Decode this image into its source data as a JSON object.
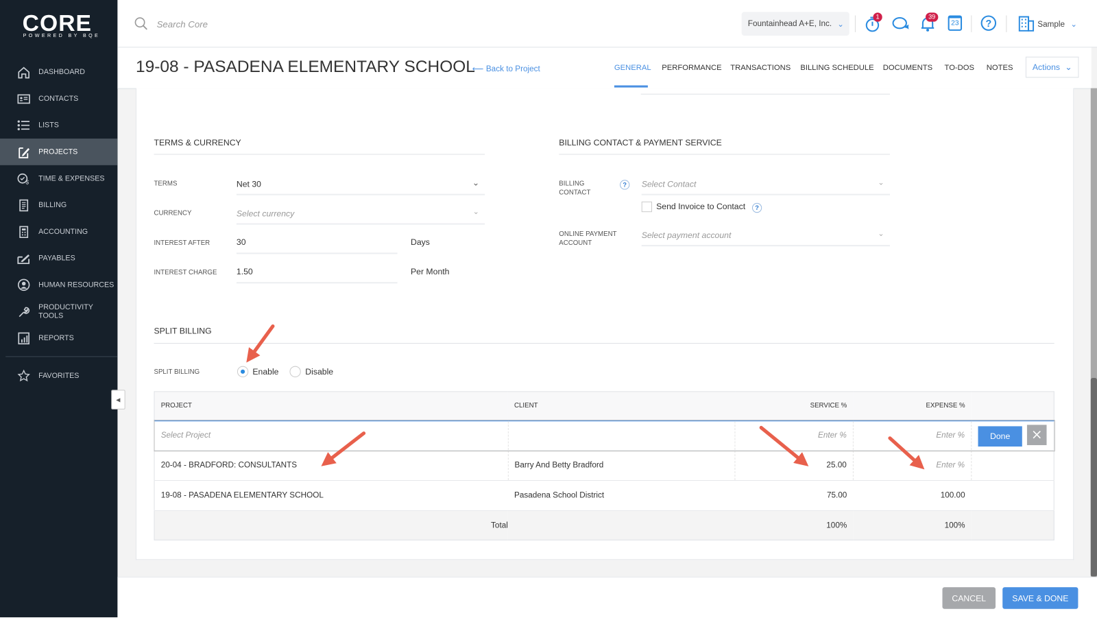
{
  "brand": {
    "logo": "CORE",
    "tagline": "POWERED BY BQE",
    "accent": "#4a90e2",
    "sidebar_bg": "#16202a",
    "annotation_arrow": "#e8604c"
  },
  "sidebar": {
    "items": [
      {
        "label": "DASHBOARD",
        "icon": "home-icon"
      },
      {
        "label": "CONTACTS",
        "icon": "contact-card-icon"
      },
      {
        "label": "LISTS",
        "icon": "list-icon"
      },
      {
        "label": "PROJECTS",
        "icon": "clipboard-edit-icon",
        "active": true
      },
      {
        "label": "TIME & EXPENSES",
        "icon": "clock-money-icon"
      },
      {
        "label": "BILLING",
        "icon": "invoice-icon"
      },
      {
        "label": "ACCOUNTING",
        "icon": "calculator-icon"
      },
      {
        "label": "PAYABLES",
        "icon": "check-signature-icon"
      },
      {
        "label": "HUMAN RESOURCES",
        "icon": "person-icon"
      },
      {
        "label": "PRODUCTIVITY TOOLS",
        "icon": "wrench-icon"
      },
      {
        "label": "REPORTS",
        "icon": "chart-icon"
      }
    ],
    "favorites": {
      "label": "FAVORITES",
      "icon": "star-icon"
    }
  },
  "topbar": {
    "search_placeholder": "Search Core",
    "company": "Fountainhead A+E, Inc.",
    "timer_badge": "1",
    "notifications_badge": "39",
    "calendar_day": "23",
    "user": "Sample"
  },
  "header": {
    "title": "19-08 - PASADENA ELEMENTARY SCHOOL",
    "back_link": "Back to Project",
    "tabs": [
      {
        "label": "GENERAL",
        "active": true
      },
      {
        "label": "PERFORMANCE"
      },
      {
        "label": "TRANSACTIONS"
      },
      {
        "label": "BILLING SCHEDULE"
      },
      {
        "label": "DOCUMENTS"
      },
      {
        "label": "TO-DOS"
      },
      {
        "label": "NOTES"
      }
    ],
    "actions_label": "Actions"
  },
  "terms": {
    "title": "TERMS & CURRENCY",
    "terms_label": "TERMS",
    "terms_value": "Net 30",
    "currency_label": "CURRENCY",
    "currency_placeholder": "Select currency",
    "interest_after_label": "INTEREST AFTER",
    "interest_after_value": "30",
    "interest_after_unit": "Days",
    "interest_charge_label": "INTEREST CHARGE",
    "interest_charge_value": "1.50",
    "interest_charge_unit": "Per Month"
  },
  "billing_contact": {
    "title": "BILLING CONTACT & PAYMENT SERVICE",
    "contact_label_1": "BILLING",
    "contact_label_2": "CONTACT",
    "contact_placeholder": "Select Contact",
    "send_invoice_label": "Send Invoice to Contact",
    "send_invoice_checked": false,
    "payment_label_1": "ONLINE PAYMENT",
    "payment_label_2": "ACCOUNT",
    "payment_placeholder": "Select payment account"
  },
  "split_billing": {
    "title": "SPLIT BILLING",
    "label": "SPLIT BILLING",
    "options": [
      "Enable",
      "Disable"
    ],
    "selected": "Enable",
    "columns": [
      "PROJECT",
      "CLIENT",
      "SERVICE %",
      "EXPENSE %"
    ],
    "edit_row": {
      "project_placeholder": "Select Project",
      "service_placeholder": "Enter %",
      "expense_placeholder": "Enter %",
      "done_label": "Done"
    },
    "rows": [
      {
        "project": "20-04 - BRADFORD: CONSULTANTS",
        "client": "Barry And Betty Bradford",
        "service": "25.00",
        "expense_placeholder": "Enter %"
      },
      {
        "project": "19-08 - PASADENA ELEMENTARY SCHOOL",
        "client": "Pasadena School District",
        "service": "75.00",
        "expense": "100.00"
      }
    ],
    "total": {
      "label": "Total",
      "service": "100%",
      "expense": "100%"
    }
  },
  "footer": {
    "cancel": "CANCEL",
    "save": "SAVE & DONE"
  }
}
